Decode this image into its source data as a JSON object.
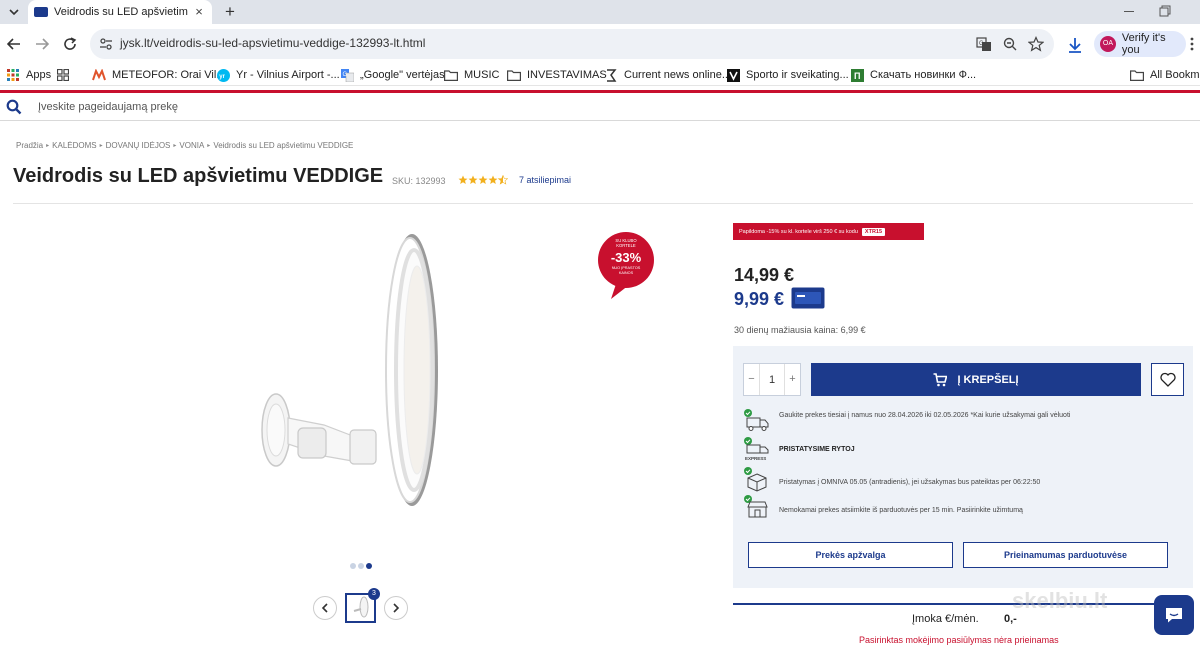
{
  "browser": {
    "tab_title": "Veidrodis su LED apšvietimu VE",
    "url": "jysk.lt/veidrodis-su-led-apsvietimu-veddige-132993-lt.html",
    "verify_label": "Verify it's you",
    "avatar_initials": "OA",
    "bookmarks": [
      {
        "label": "Apps",
        "icon": "apps-grid-icon"
      },
      {
        "label": "",
        "icon": "tab-groups-icon"
      },
      {
        "label": "METEOFOR: Orai Vil...",
        "icon": "meteofor-icon"
      },
      {
        "label": "Yr - Vilnius Airport -...",
        "icon": "yr-icon"
      },
      {
        "label": "„Google\" vertėjas",
        "icon": "translate-icon"
      },
      {
        "label": "MUSIC",
        "icon": "folder-icon"
      },
      {
        "label": "INVESTAVIMAS",
        "icon": "folder-icon"
      },
      {
        "label": "Current news online...",
        "icon": "news-icon"
      },
      {
        "label": "Sporto ir sveikating...",
        "icon": "v-icon"
      },
      {
        "label": "Скачать новинки Ф...",
        "icon": "download-site-icon"
      },
      {
        "label": "All Bookmarks",
        "icon": "folder-icon"
      }
    ]
  },
  "search": {
    "placeholder": "Įveskite pageidaujamą prekę"
  },
  "breadcrumb": [
    "Pradžia",
    "KALĖDOMS",
    "DOVANŲ IDĖJOS",
    "VONIA",
    "Veidrodis su LED apšvietimu VEDDIGE"
  ],
  "product": {
    "title": "Veidrodis su LED apšvietimu VEDDIGE",
    "sku": "SKU: 132993",
    "rating": 4.5,
    "reviews": "7 atsiliepimai"
  },
  "badge": {
    "line1": "SU KLUBO",
    "line2": "KORTELE",
    "discount": "-33%",
    "line3": "NUO ĮPRASTOS",
    "line4": "KAINOS"
  },
  "gallery": {
    "image_count": "3",
    "active_index": 3
  },
  "promo": {
    "text": "Papildoma -15% su kl. kortele virš 250 € su kodu",
    "code": "XTR15"
  },
  "pricing": {
    "regular": "14,99  €",
    "club": "9,99 €",
    "lowest_30d": "30 dienų mažiausia kaina: 6,99 €"
  },
  "cart": {
    "quantity": "1",
    "minus": "−",
    "plus": "+",
    "add_label": "Į KREPŠELĮ"
  },
  "delivery": [
    {
      "icon": "delivery-truck-icon",
      "text": "Gaukite prekes tiesiai į namus nuo 28.04.2026 iki 02.05.2026 *Kai kurie užsakymai gali vėluoti"
    },
    {
      "icon": "express-truck-icon",
      "text": "PRISTATYSIME RYTOJ"
    },
    {
      "icon": "parcel-box-icon",
      "text": "Pristatymas į OMNIVA 05.05 (antradienis), jei užsakymas bus pateiktas per 06:22:50"
    },
    {
      "icon": "store-icon",
      "text": "Nemokamai prekes atsiimkite iš parduotuvės per 15 min. Pasiirinkite užimtumą"
    }
  ],
  "buttons": {
    "overview": "Prekės apžvalga",
    "availability": "Prieinamumas parduotuvėse"
  },
  "installment": {
    "label": "Įmoka €/mėn.",
    "value": "0,-",
    "note": "Pasirinktas mokėjimo pasiūlymas nėra prieinamas"
  },
  "watermark": "skelbiu.lt",
  "colors": {
    "brand_blue": "#1c3a8c",
    "brand_red": "#c8102e",
    "panel_bg": "#eef2f8"
  }
}
